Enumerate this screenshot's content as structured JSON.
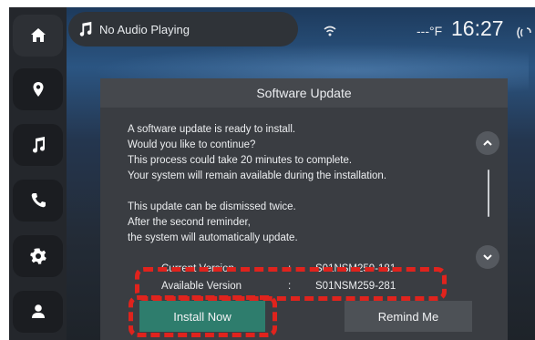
{
  "status": {
    "audio_label": "No Audio Playing",
    "temperature": "---°F",
    "time": "16:27"
  },
  "sidebar": {
    "items": [
      {
        "icon": "home-icon"
      },
      {
        "icon": "location-pin-icon"
      },
      {
        "icon": "music-note-icon"
      },
      {
        "icon": "phone-icon"
      },
      {
        "icon": "settings-gear-icon"
      },
      {
        "icon": "profile-icon"
      }
    ]
  },
  "dialog": {
    "title": "Software Update",
    "lines": [
      "A software update is ready to install.",
      "Would you like to continue?",
      "This process could take 20 minutes to complete.",
      "Your system will remain available during the installation.",
      "This update can be dismissed twice.",
      "After the second reminder,",
      "the system will automatically update."
    ],
    "current_version_label": "Current Version",
    "current_version_value": "S01NSM259-181",
    "available_version_label": "Available Version",
    "available_version_value": "S01NSM259-281",
    "separator": ":",
    "install_label": "Install Now",
    "remind_label": "Remind Me"
  },
  "colors": {
    "install_button": "#2e7d6d",
    "highlight": "#e0231d"
  }
}
